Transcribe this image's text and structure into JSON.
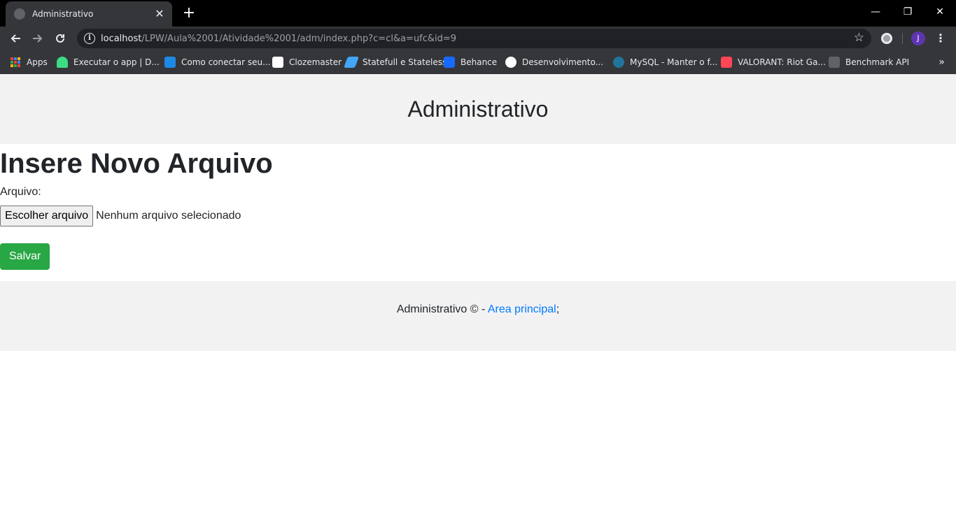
{
  "browser": {
    "tab_title": "Administrativo",
    "tab_close": "✕",
    "new_tab": "+",
    "window_controls": {
      "minimize": "—",
      "restore": "❐",
      "close": "✕"
    },
    "url_host": "localhost",
    "url_path": "/LPW/Aula%2001/Atividade%2001/adm/index.php?c=cl&a=ufc&id=9",
    "profile_initial": "J",
    "bookmarks": [
      {
        "label": "Apps",
        "icon": "apps-grid-icon",
        "color": "#ea4335"
      },
      {
        "label": "Executar o app | D...",
        "icon": "android-icon",
        "color": "#3ddc84"
      },
      {
        "label": "Como conectar seu...",
        "icon": "m-logo-icon",
        "color": "#1e88e5"
      },
      {
        "label": "Clozemaster",
        "icon": "clozemaster-icon",
        "color": "#ffffff"
      },
      {
        "label": "Statefull e Stateless",
        "icon": "flutter-icon",
        "color": "#42a5f5"
      },
      {
        "label": "Behance",
        "icon": "behance-icon",
        "color": "#1769ff"
      },
      {
        "label": "Desenvolvimento...",
        "icon": "globe-icon",
        "color": "#ffffff"
      },
      {
        "label": "MySQL - Manter o f...",
        "icon": "wordpress-icon",
        "color": "#21759b"
      },
      {
        "label": "VALORANT: Riot Ga...",
        "icon": "valorant-icon",
        "color": "#ff4655"
      },
      {
        "label": "Benchmark API",
        "icon": "benchmark-icon",
        "color": "#5f6368"
      }
    ],
    "bookmarks_more": "»"
  },
  "page": {
    "header_title": "Administrativo",
    "heading": "Insere Novo Arquivo",
    "file_label": "Arquivo:",
    "file_button": "Escolher arquivo",
    "file_status": "Nenhum arquivo selecionado",
    "save_button": "Salvar",
    "footer_text": "Administrativo © - ",
    "footer_link": "Area principal",
    "footer_suffix": ";"
  },
  "colors": {
    "save_button": "#28a745",
    "link": "#007bff",
    "band_background": "#f2f2f2"
  }
}
